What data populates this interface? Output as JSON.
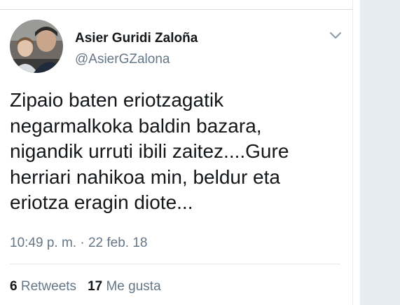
{
  "tweet": {
    "author_name": "Asier Guridi Zaloña",
    "author_handle": "@AsierGZalona",
    "text_lines": [
      "Zipaio baten eriotzagatik",
      "negarmalkoka baldin bazara,",
      "nigandik urruti ibili zaitez....Gure",
      "herriari nahikoa min, beldur eta",
      "eriotza eragin diote..."
    ],
    "timestamp": "10:49 p. m. · 22 feb. 18",
    "retweets_count": "6",
    "retweets_label": "Retweets",
    "likes_count": "17",
    "likes_label": "Me gusta"
  },
  "icons": {
    "menu": "chevron-down-icon",
    "avatar": "avatar"
  },
  "colors": {
    "text": "#14171a",
    "secondary": "#657786",
    "divider": "#e1e8ed",
    "panel": "#e6ecf0"
  }
}
